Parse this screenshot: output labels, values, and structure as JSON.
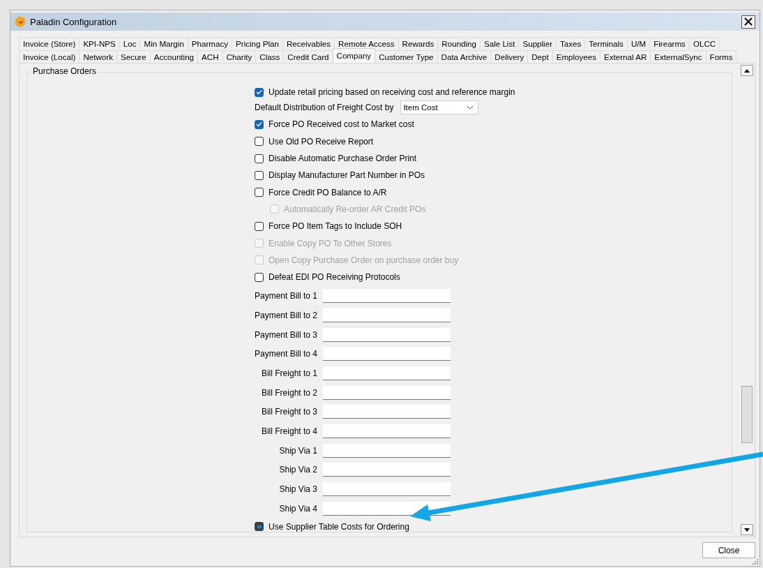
{
  "window": {
    "title": "Paladin Configuration"
  },
  "tab_rows": [
    [
      {
        "label": "Invoice (Store)",
        "selected": false
      },
      {
        "label": "KPI-NPS",
        "selected": false
      },
      {
        "label": "Loc",
        "selected": false
      },
      {
        "label": "Min Margin",
        "selected": false
      },
      {
        "label": "Pharmacy",
        "selected": false
      },
      {
        "label": "Pricing Plan",
        "selected": false
      },
      {
        "label": "Receivables",
        "selected": false
      },
      {
        "label": "Remote Access",
        "selected": false
      },
      {
        "label": "Rewards",
        "selected": false
      },
      {
        "label": "Rounding",
        "selected": false
      },
      {
        "label": "Sale List",
        "selected": false
      },
      {
        "label": "Supplier",
        "selected": false
      },
      {
        "label": "Taxes",
        "selected": false
      },
      {
        "label": "Terminals",
        "selected": false
      },
      {
        "label": "U/M",
        "selected": false
      },
      {
        "label": "Firearms",
        "selected": false
      },
      {
        "label": "OLCC",
        "selected": false
      }
    ],
    [
      {
        "label": "Invoice (Local)",
        "selected": false
      },
      {
        "label": "Network",
        "selected": false
      },
      {
        "label": "Secure",
        "selected": false
      },
      {
        "label": "Accounting",
        "selected": false
      },
      {
        "label": "ACH",
        "selected": false
      },
      {
        "label": "Charity",
        "selected": false
      },
      {
        "label": "Class",
        "selected": false
      },
      {
        "label": "Credit Card",
        "selected": false
      },
      {
        "label": "Company",
        "selected": true
      },
      {
        "label": "Customer Type",
        "selected": false
      },
      {
        "label": "Data Archive",
        "selected": false
      },
      {
        "label": "Delivery",
        "selected": false
      },
      {
        "label": "Dept",
        "selected": false
      },
      {
        "label": "Employees",
        "selected": false
      },
      {
        "label": "External AR",
        "selected": false
      },
      {
        "label": "ExternalSync",
        "selected": false
      },
      {
        "label": "Forms",
        "selected": false
      }
    ]
  ],
  "group": {
    "title": "Purchase Orders",
    "settings": [
      {
        "kind": "checkbox",
        "label": "Update retail pricing based on receiving cost and reference margin",
        "checked": true,
        "disabled": false,
        "indeterminate": false
      },
      {
        "kind": "dropdown",
        "label": "Default Distribution of Freight Cost by",
        "value": "Item Cost"
      },
      {
        "kind": "checkbox",
        "label": "Force PO Received cost to Market cost",
        "checked": true,
        "disabled": false,
        "indeterminate": false
      },
      {
        "kind": "checkbox",
        "label": "Use Old PO Receive Report",
        "checked": false,
        "disabled": false,
        "indeterminate": false
      },
      {
        "kind": "checkbox",
        "label": "Disable Automatic Purchase Order Print",
        "checked": false,
        "disabled": false,
        "indeterminate": false
      },
      {
        "kind": "checkbox",
        "label": "Display Manufacturer Part Number in POs",
        "checked": false,
        "disabled": false,
        "indeterminate": false
      },
      {
        "kind": "checkbox",
        "label": "Force Credit PO Balance to A/R",
        "checked": false,
        "disabled": false,
        "indeterminate": false,
        "children": [
          {
            "kind": "checkbox",
            "label": "Automatically Re-order AR Credit POs",
            "checked": false,
            "disabled": true,
            "indeterminate": false
          }
        ]
      },
      {
        "kind": "checkbox",
        "label": "Force PO Item Tags to Include SOH",
        "checked": false,
        "disabled": false,
        "indeterminate": false
      },
      {
        "kind": "checkbox",
        "label": "Enable Copy PO To Other Stores",
        "checked": false,
        "disabled": true,
        "indeterminate": false
      },
      {
        "kind": "checkbox",
        "label": "Open Copy Purchase Order on purchase order buy",
        "checked": false,
        "disabled": true,
        "indeterminate": false
      },
      {
        "kind": "checkbox",
        "label": "Defeat EDI PO Receiving Protocols",
        "checked": false,
        "disabled": false,
        "indeterminate": false
      },
      {
        "kind": "field",
        "label": "Payment Bill to 1"
      },
      {
        "kind": "field",
        "label": "Payment Bill to 2"
      },
      {
        "kind": "field",
        "label": "Payment Bill to 3"
      },
      {
        "kind": "field",
        "label": "Payment Bill to 4"
      },
      {
        "kind": "field",
        "label": "Bill Freight to 1"
      },
      {
        "kind": "field",
        "label": "Bill Freight to 2"
      },
      {
        "kind": "field",
        "label": "Bill Freight to 3"
      },
      {
        "kind": "field",
        "label": "Bill Freight to 4"
      },
      {
        "kind": "field",
        "label": "Ship Via 1"
      },
      {
        "kind": "field",
        "label": "Ship Via 2"
      },
      {
        "kind": "field",
        "label": "Ship Via 3"
      },
      {
        "kind": "field",
        "label": "Ship Via 4"
      },
      {
        "kind": "checkbox",
        "label": "Use Supplier Table Costs for Ordering",
        "checked": false,
        "disabled": false,
        "indeterminate": true
      }
    ]
  },
  "buttons": {
    "close": "Close"
  }
}
